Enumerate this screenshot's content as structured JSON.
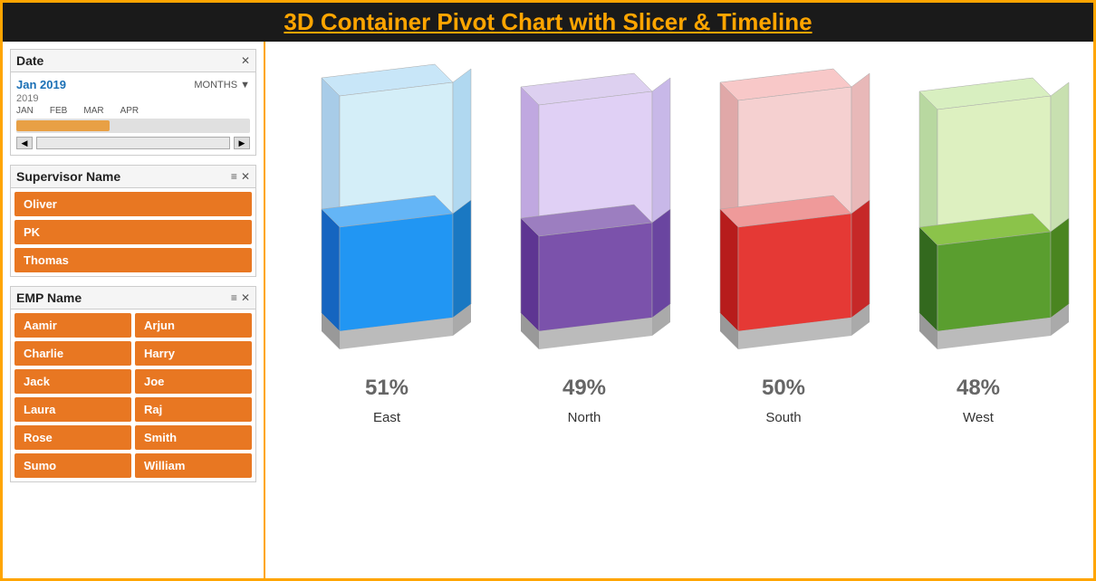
{
  "title": "3D Container Pivot Chart with Slicer & Timeline",
  "date_slicer": {
    "title": "Date",
    "selected_date": "Jan 2019",
    "period_label": "MONTHS",
    "year": "2019",
    "months": [
      "JAN",
      "FEB",
      "MAR",
      "APR"
    ]
  },
  "supervisor_slicer": {
    "title": "Supervisor Name",
    "items": [
      "Oliver",
      "PK",
      "Thomas"
    ]
  },
  "emp_slicer": {
    "title": "EMP Name",
    "items_col1": [
      "Aamir",
      "Charlie",
      "Jack",
      "Laura",
      "Rose",
      "Sumo"
    ],
    "items_col2": [
      "Arjun",
      "Harry",
      "Joe",
      "Raj",
      "Smith",
      "William"
    ]
  },
  "chart": {
    "bars": [
      {
        "region": "East",
        "pct": "51%",
        "fill_color": "#2196F3",
        "ghost_color": "#b3d9f7"
      },
      {
        "region": "North",
        "pct": "49%",
        "fill_color": "#7B52AB",
        "ghost_color": "#c9b3e0"
      },
      {
        "region": "South",
        "pct": "50%",
        "fill_color": "#e53935",
        "ghost_color": "#f5b3b3"
      },
      {
        "region": "West",
        "pct": "48%",
        "fill_color": "#5a9e2f",
        "ghost_color": "#bfe09a"
      }
    ]
  }
}
